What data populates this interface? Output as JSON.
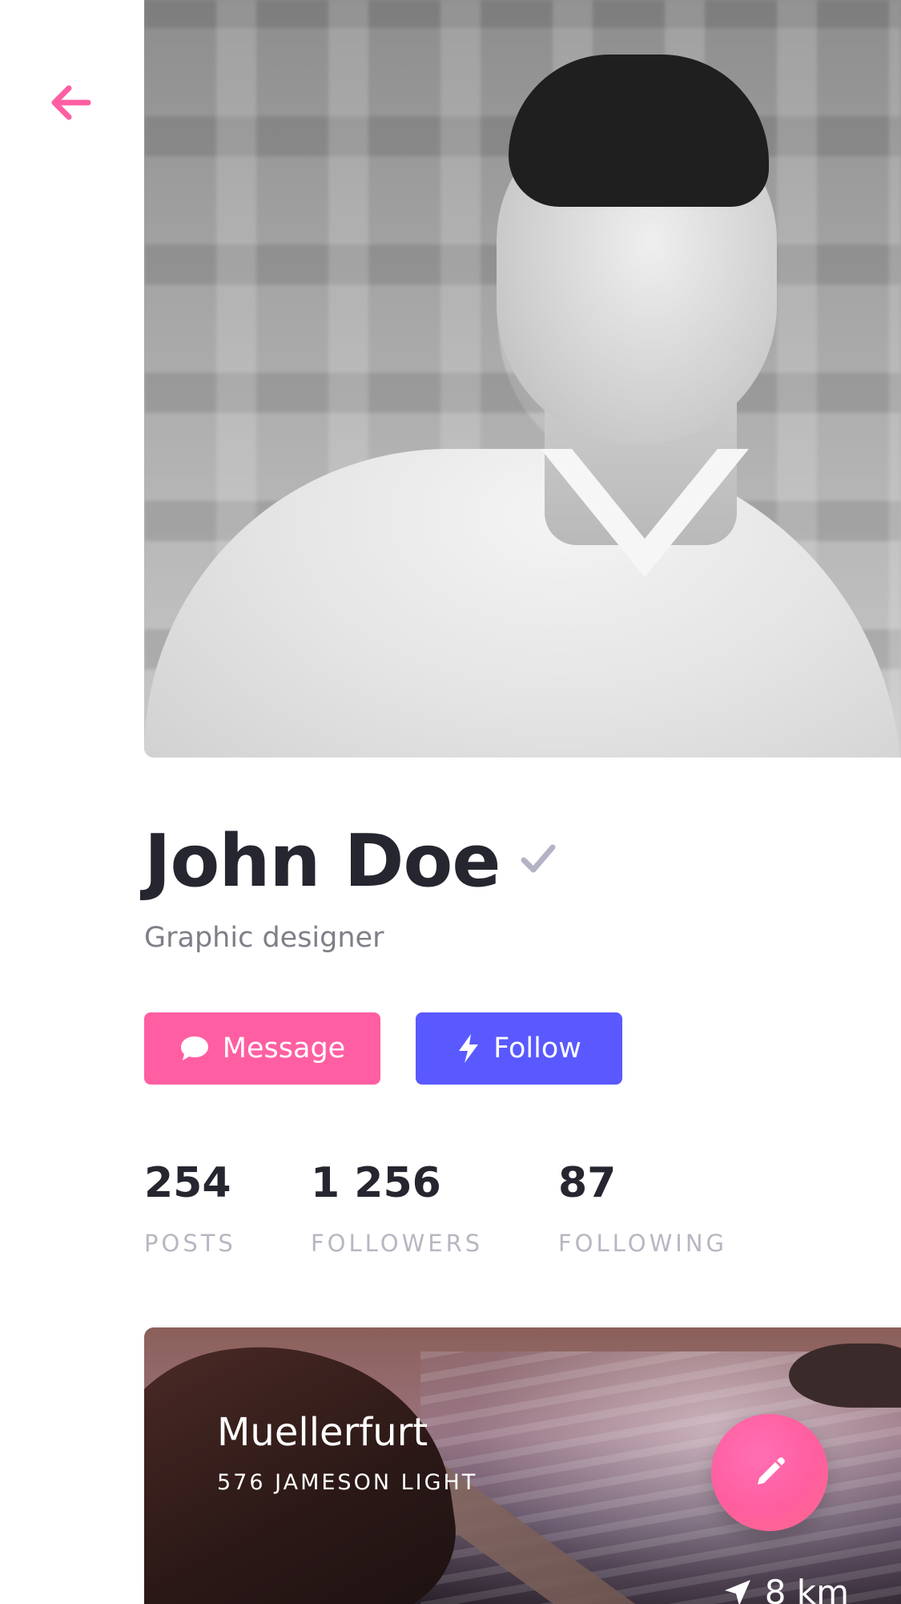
{
  "profile": {
    "name": "John Doe",
    "role": "Graphic designer"
  },
  "actions": {
    "message_label": "Message",
    "follow_label": "Follow"
  },
  "stats": [
    {
      "value": "254",
      "label": "POSTS"
    },
    {
      "value": "1 256",
      "label": "FOLLOWERS"
    },
    {
      "value": "87",
      "label": "FOLLOWING"
    }
  ],
  "location_card": {
    "title": "Muellerfurt",
    "subtitle": "576 JAMESON LIGHT",
    "distance": "8 km"
  },
  "icons": {
    "back": "arrow-left-icon",
    "verified": "checkmark-icon",
    "message": "chat-bubble-icon",
    "follow": "lightning-bolt-icon",
    "distance": "location-arrow-icon",
    "fab": "pencil-icon"
  },
  "colors": {
    "accent_pink": "#ff5fa2",
    "accent_blue": "#5959ff",
    "text_dark": "#262630",
    "text_muted": "#7f7f89",
    "label_muted": "#b7b7c3",
    "verified_gray": "#b3b3c4"
  }
}
